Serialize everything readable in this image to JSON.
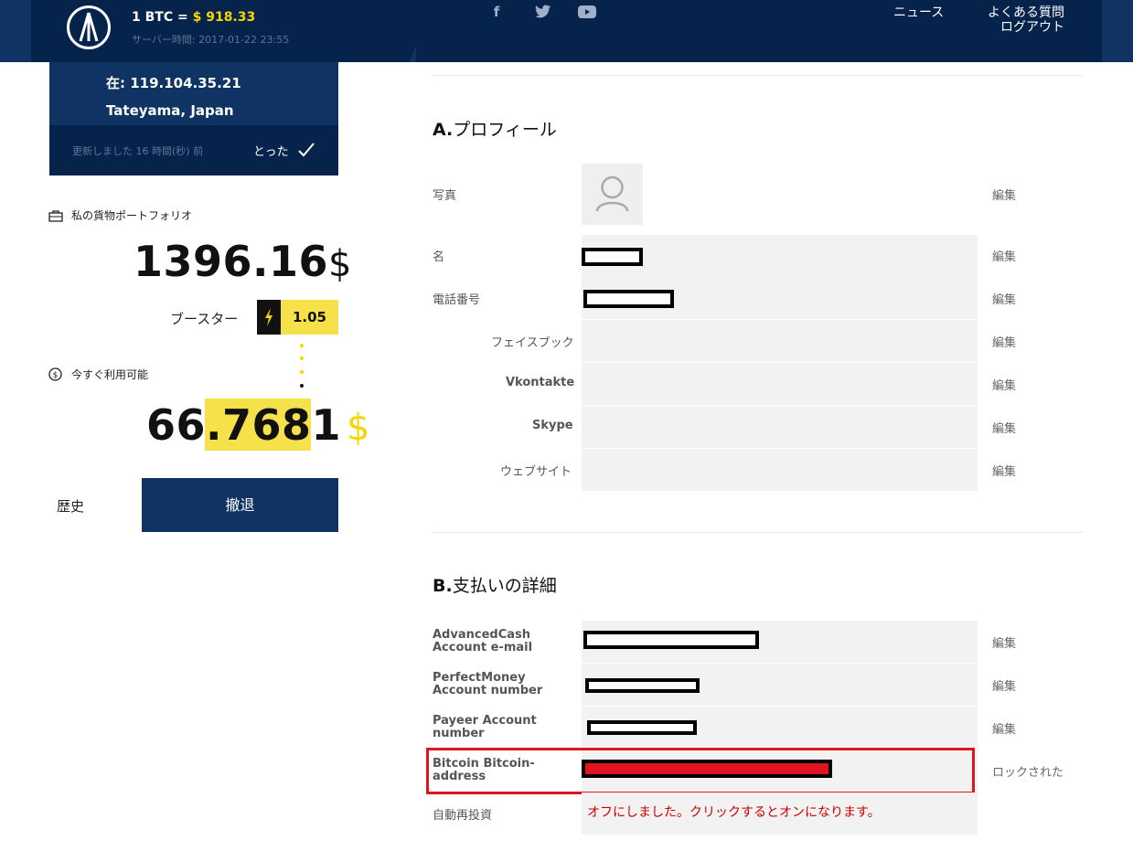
{
  "header": {
    "btc_prefix": "1 BTC = ",
    "btc_price": "$ 918.33",
    "server_time": "サーバー時間: 2017-01-22 23:55",
    "social": [
      "f",
      "t",
      "▶"
    ],
    "nav": {
      "news": "ニュース",
      "faq": "よくある質問",
      "logout": "ログアウト"
    }
  },
  "location": {
    "text": "在: 119.104.35.21 Tateyama, Japan"
  },
  "updated": {
    "text": "更新しました 16 時間(秒) 前",
    "took": "とった"
  },
  "portfolio": {
    "label": "私の貨物ポートフォリオ",
    "value": "1396.16",
    "currency": "$",
    "booster_label": "ブースター",
    "booster_value": "1.05",
    "available_label": "今すぐ利用可能",
    "available_int": "66.",
    "available_dec": "7681",
    "available_currency": "$",
    "history": "歴史",
    "withdraw": "撤退"
  },
  "profile": {
    "title_prefix": "A.",
    "title": "プロフィール",
    "rows": [
      {
        "label": "写真",
        "edit": "編集"
      },
      {
        "label": "名",
        "edit": "編集"
      },
      {
        "label": "電話番号",
        "edit": "編集"
      },
      {
        "label": "フェイスブック",
        "edit": "編集"
      },
      {
        "label": "Vkontakte",
        "edit": "編集"
      },
      {
        "label": "Skype",
        "edit": "編集"
      },
      {
        "label": "ウェブサイト",
        "edit": "編集"
      }
    ]
  },
  "payment": {
    "title_prefix": "B.",
    "title": "支払いの詳細",
    "rows": [
      {
        "label": "AdvancedCash Account e-mail",
        "edit": "編集"
      },
      {
        "label": "PerfectMoney Account number",
        "edit": "編集"
      },
      {
        "label": "Payeer Account number",
        "edit": "編集"
      },
      {
        "label": "Bitcoin Bitcoin-address",
        "edit": "ロックされた"
      },
      {
        "label": "自動再投資",
        "value": "オフにしました。クリックするとオンになります。"
      }
    ]
  },
  "colors": {
    "navy": "#0f3463",
    "navy_dark": "#06234b",
    "yellow": "#f6e14a",
    "red": "#e0151f"
  }
}
